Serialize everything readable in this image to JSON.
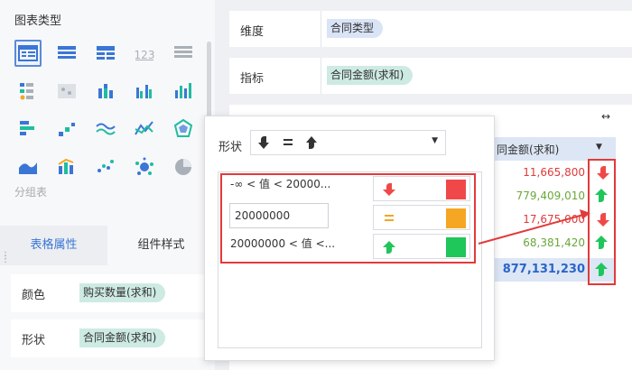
{
  "left_panel": {
    "chart_type_title": "图表类型",
    "group_label": "分组表",
    "chart_icons": [
      "grouped-table-icon",
      "detail-table-icon",
      "cross-table-icon",
      "kpi-number-icon",
      "list-table-icon",
      "color-table-icon",
      "map-table-icon",
      "stacked-bar-icon",
      "multi-bar-icon",
      "column-chart-icon",
      "horizontal-bar-icon",
      "scatter-step-icon",
      "line-wave-icon",
      "line-chart-icon",
      "radar-chart-icon",
      "area-chart-icon",
      "combo-chart-icon",
      "scatter-chart-icon",
      "bubble-chart-icon",
      "pie-chart-icon"
    ],
    "tabs": {
      "table_props": "表格属性",
      "component_style": "组件样式"
    },
    "props": {
      "color_label": "颜色",
      "color_field": "购买数量(求和)",
      "shape_label": "形状",
      "shape_field": "合同金额(求和)"
    }
  },
  "right_panel": {
    "dimension_label": "维度",
    "dimension_field": "合同类型",
    "indicator_label": "指标",
    "indicator_field": "合同金额(求和)",
    "column_header": "同金额(求和)",
    "rows": [
      {
        "value": "11,665,800",
        "color": "#e13a3a",
        "arrow": "down"
      },
      {
        "value": "779,409,010",
        "color": "#6aa83a",
        "arrow": "up"
      },
      {
        "value": "17,675,000",
        "color": "#e13a3a",
        "arrow": "down"
      },
      {
        "value": "68,381,420",
        "color": "#6aa83a",
        "arrow": "up"
      }
    ],
    "total": {
      "value": "877,131,230",
      "arrow": "up"
    }
  },
  "popup": {
    "shape_label": "形状",
    "rules": [
      {
        "condition": "-∞ < 值 < 20000...",
        "symbol": "down-arrow",
        "color": "#f04848"
      },
      {
        "threshold_value": "20000000",
        "symbol": "equals",
        "color": "#f5a623"
      },
      {
        "condition": "20000000 < 值 <...",
        "symbol": "up-arrow",
        "color": "#1fc65a"
      }
    ]
  }
}
